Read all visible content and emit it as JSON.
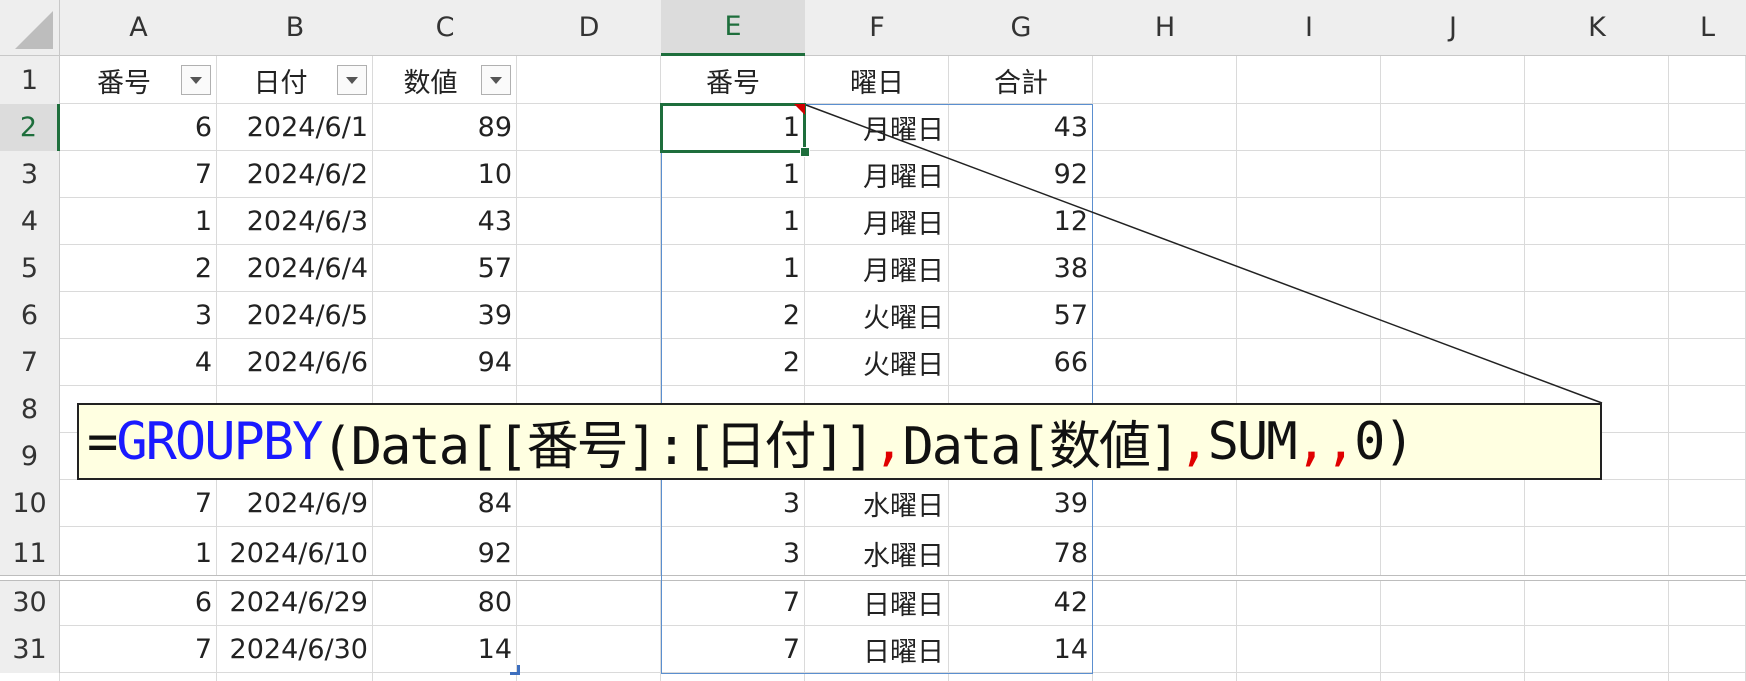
{
  "columns": [
    "A",
    "B",
    "C",
    "D",
    "E",
    "F",
    "G",
    "H",
    "I",
    "J",
    "K",
    "L"
  ],
  "rows": [
    "1",
    "2",
    "3",
    "4",
    "5",
    "6",
    "7",
    "8",
    "9",
    "10",
    "11",
    "30",
    "31"
  ],
  "source_table": {
    "headers": [
      "番号",
      "日付",
      "数値"
    ],
    "rows": [
      [
        "6",
        "2024/6/1",
        "89"
      ],
      [
        "7",
        "2024/6/2",
        "10"
      ],
      [
        "1",
        "2024/6/3",
        "43"
      ],
      [
        "2",
        "2024/6/4",
        "57"
      ],
      [
        "3",
        "2024/6/5",
        "39"
      ],
      [
        "4",
        "2024/6/6",
        "94"
      ],
      [
        "",
        "",
        ""
      ],
      [
        "",
        "",
        ""
      ],
      [
        "7",
        "2024/6/9",
        "84"
      ],
      [
        "1",
        "2024/6/10",
        "92"
      ],
      [
        "6",
        "2024/6/29",
        "80"
      ],
      [
        "7",
        "2024/6/30",
        "14"
      ]
    ]
  },
  "result_table": {
    "headers": [
      "番号",
      "曜日",
      "合計"
    ],
    "rows": [
      [
        "1",
        "月曜日",
        "43"
      ],
      [
        "1",
        "月曜日",
        "92"
      ],
      [
        "1",
        "月曜日",
        "12"
      ],
      [
        "1",
        "月曜日",
        "38"
      ],
      [
        "2",
        "火曜日",
        "57"
      ],
      [
        "2",
        "火曜日",
        "66"
      ],
      [
        "",
        "",
        ""
      ],
      [
        "",
        "",
        ""
      ],
      [
        "3",
        "水曜日",
        "39"
      ],
      [
        "3",
        "水曜日",
        "78"
      ],
      [
        "7",
        "日曜日",
        "42"
      ],
      [
        "7",
        "日曜日",
        "14"
      ]
    ]
  },
  "formula": {
    "eq": "=",
    "fn": "GROUPBY",
    "part1": "(Data[[番号]:[日付]]",
    "comma1": ",",
    "part2": "Data[数値]",
    "comma2": ",",
    "part3": "SUM",
    "comma3": ",",
    "comma4": ",",
    "part4": "0)"
  },
  "colors": {
    "active_cell": "#1e6e3c",
    "spill_border": "#5b8fcf",
    "function_name": "#1a1aff",
    "separator": "#e00000",
    "callout_bg": "#ffffe1"
  }
}
